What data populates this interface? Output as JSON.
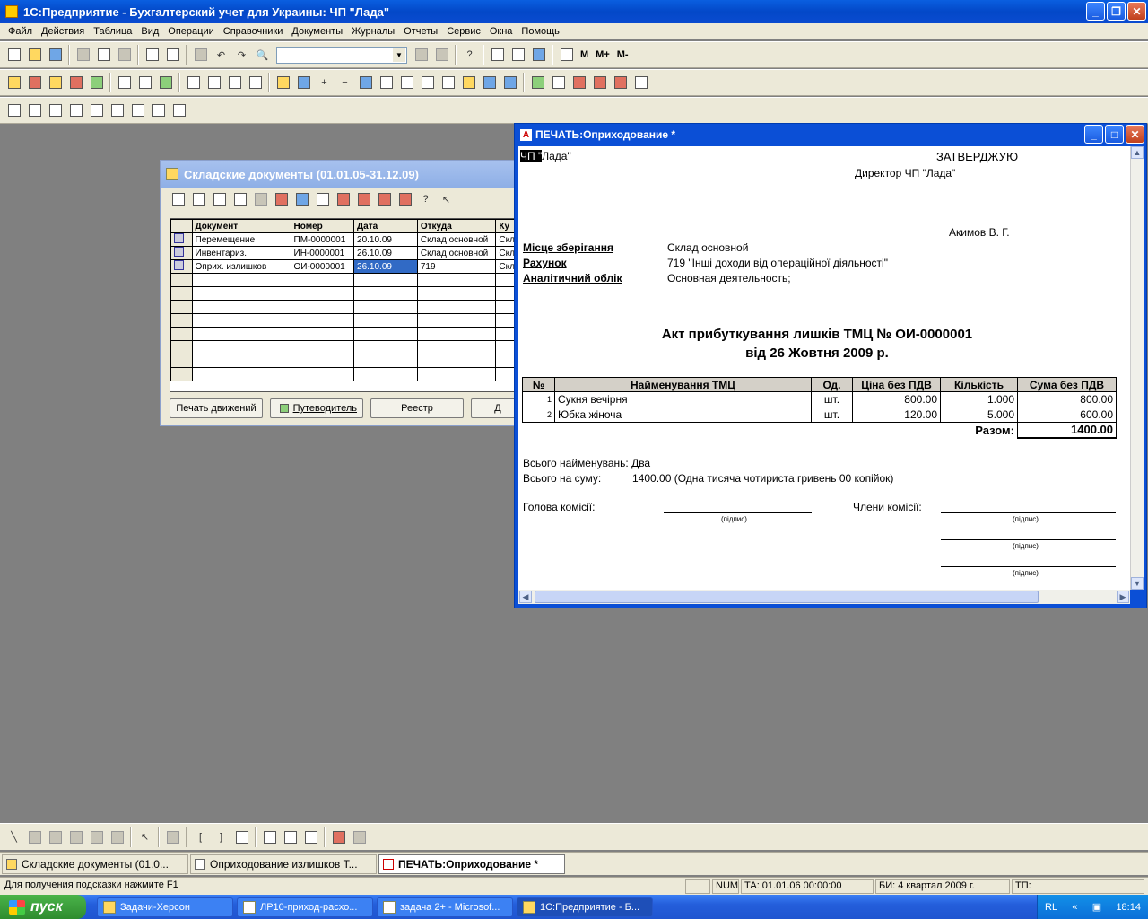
{
  "app": {
    "title": "1С:Предприятие - Бухгалтерский учет для Украины: ЧП \"Лада\"",
    "menu": [
      "Файл",
      "Действия",
      "Таблица",
      "Вид",
      "Операции",
      "Справочники",
      "Документы",
      "Журналы",
      "Отчеты",
      "Сервис",
      "Окна",
      "Помощь"
    ],
    "toolbar_mem_buttons": [
      "M",
      "M+",
      "M-"
    ]
  },
  "sklad": {
    "title": "Складские документы (01.01.05-31.12.09)",
    "columns": [
      "Документ",
      "Номер",
      "Дата",
      "Откуда",
      "Ку"
    ],
    "rows": [
      {
        "doc": "Перемещение",
        "num": "ПМ-0000001",
        "date": "20.10.09",
        "from": "Склад основной",
        "to": "Скл"
      },
      {
        "doc": "Инвентариз.",
        "num": "ИН-0000001",
        "date": "26.10.09",
        "from": "Склад основной",
        "to": "Скл"
      },
      {
        "doc": "Оприх. излишков",
        "num": "ОИ-0000001",
        "date": "26.10.09",
        "from": "719",
        "to": "Скл"
      }
    ],
    "buttons": {
      "print": "Печать движений",
      "guide": "Путеводитель",
      "registry": "Реестр",
      "more": "Д"
    }
  },
  "print": {
    "title": "ПЕЧАТЬ:Оприходование  *",
    "org_sel": "ЧП \"",
    "org_rest": "Лада\"",
    "approve": "ЗАТВЕРДЖУЮ",
    "director": "Директор ЧП \"Лада\"",
    "director_name": "Акимов В. Г.",
    "place_label": "Місце зберігання",
    "place_value": "Склад основной",
    "account_label": "Рахунок",
    "account_value": "719 \"Інші доходи від операційної діяльності\"",
    "analytic_label": "Аналітичний облік",
    "analytic_value": "Основная деятельность;",
    "heading1": "Акт прибуткування лишків ТМЦ № ОИ-0000001",
    "heading2": "від 26 Жовтня 2009 р.",
    "table_headers": [
      "№",
      "Найменування ТМЦ",
      "Од.",
      "Ціна без ПДВ",
      "Кількість",
      "Сума без ПДВ"
    ],
    "items": [
      {
        "n": "1",
        "name": "Сукня вечірня",
        "unit": "шт.",
        "price": "800.00",
        "qty": "1.000",
        "sum": "800.00"
      },
      {
        "n": "2",
        "name": "Юбка жіноча",
        "unit": "шт.",
        "price": "120.00",
        "qty": "5.000",
        "sum": "600.00"
      }
    ],
    "total_label": "Разом:",
    "total_value": "1400.00",
    "count_text": "Всього найменувань: Два",
    "sum_label": "Всього на суму:",
    "sum_text": "1400.00 (Одна тисяча чотириста гривень 00 копійок)",
    "head_commission": "Голова комісії:",
    "members_commission": "Члени комісії:",
    "sign_caption": "(підпис)"
  },
  "window_tabs": [
    "Складские документы (01.0...",
    "Оприходование излишков Т...",
    "ПЕЧАТЬ:Оприходование   *"
  ],
  "status": {
    "hint": "Для получения подсказки нажмите F1",
    "num": "NUM",
    "ta": "ТА: 01.01.06  00:00:00",
    "bi": "БИ: 4 квартал 2009 г.",
    "tp": "ТП:"
  },
  "taskbar": {
    "start": "пуск",
    "items": [
      "Задачи-Херсон",
      "ЛР10-приход-расхо...",
      "задача 2+ - Microsof...",
      "1С:Предприятие - Б..."
    ],
    "lang": "RL",
    "clock": "18:14"
  }
}
